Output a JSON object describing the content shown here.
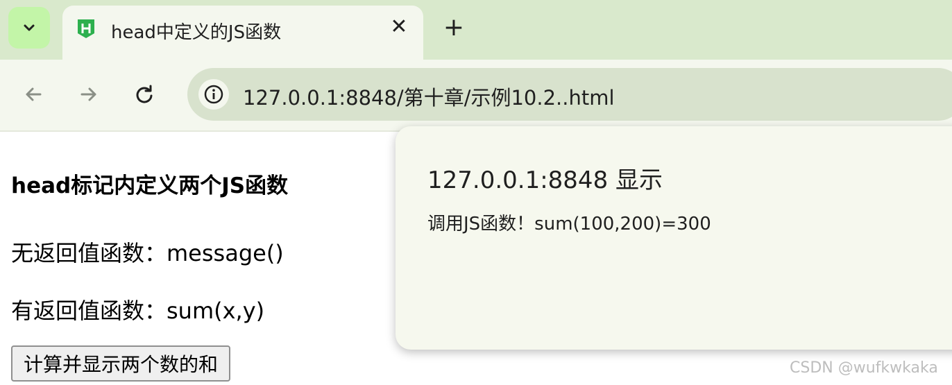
{
  "browser": {
    "tab": {
      "title": "head中定义的JS函数",
      "favicon": "hbuilder-h-icon",
      "close_symbol": "✕"
    },
    "new_tab_symbol": "+",
    "address_bar": {
      "url": "127.0.0.1:8848/第十章/示例10.2..html"
    }
  },
  "page": {
    "heading": "head标记内定义两个JS函数",
    "line1": "无返回值函数：message()",
    "line2": "有返回值函数：sum(x,y)",
    "button_label": "计算并显示两个数的和"
  },
  "dialog": {
    "title": "127.0.0.1:8848 显示",
    "message": "调用JS函数！sum(100,200)=300"
  },
  "watermark": "CSDN @wufkwkaka",
  "colors": {
    "tabstrip_bg": "#d9e9cc",
    "toolbar_bg": "#f4f7ee",
    "omnibox_bg": "#d8e2cd",
    "favicon_green": "#2db04e"
  }
}
